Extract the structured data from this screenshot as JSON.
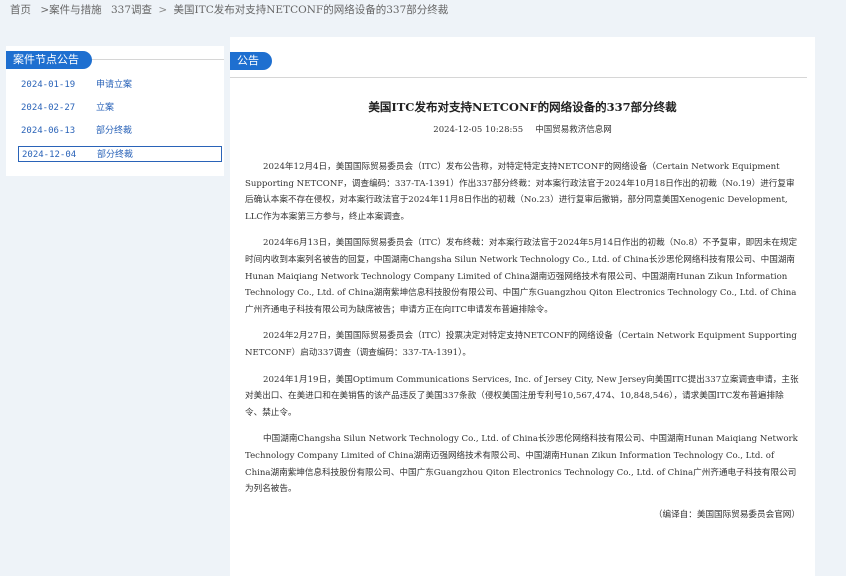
{
  "breadcrumb": {
    "home": "首页",
    "cases": ">案件与措施",
    "section": "337调查",
    "sep": ">",
    "current": "美国ITC发布对支持NETCONF的网络设备的337部分终裁"
  },
  "nodes": {
    "heading": "案件节点公告",
    "items": [
      {
        "date": "2024-01-19",
        "label": "申请立案"
      },
      {
        "date": "2024-02-27",
        "label": "立案"
      },
      {
        "date": "2024-06-13",
        "label": "部分终裁"
      },
      {
        "date": "2024-12-04",
        "label": "部分终裁"
      }
    ]
  },
  "article": {
    "heading": "公告",
    "title": "美国ITC发布对支持NETCONF的网络设备的337部分终裁",
    "datetime": "2024-12-05 10:28:55",
    "source": "中国贸易救济信息网",
    "paragraphs": [
      "2024年12月4日，美国国际贸易委员会（ITC）发布公告称，对特定特定支持NETCONF的网络设备（Certain Network Equipment Supporting NETCONF，调查编码：337-TA-1391）作出337部分终裁：对本案行政法官于2024年10月18日作出的初裁（No.19）进行复审后确认本案不存在侵权，对本案行政法官于2024年11月8日作出的初裁（No.23）进行复审后撤销，部分同意美国Xenogenic Development, LLC作为本案第三方参与，终止本案调查。",
      "2024年6月13日，美国国际贸易委员会（ITC）发布终裁：对本案行政法官于2024年5月14日作出的初裁（No.8）不予复审，即因未在规定时间内收到本案列名被告的回复，中国湖南Changsha Silun Network Technology Co., Ltd. of China长沙思伦网络科技有限公司、中国湖南Hunan Maiqiang Network Technology Company Limited of China湖南迈强网络技术有限公司、中国湖南Hunan Zikun Information Technology Co., Ltd. of China湖南紫坤信息科技股份有限公司、中国广东Guangzhou Qiton Electronics Technology Co., Ltd. of China广州齐通电子科技有限公司为缺席被告；申请方正在向ITC申请发布普遍排除令。",
      "2024年2月27日，美国国际贸易委员会（ITC）投票决定对特定支持NETCONF的网络设备（Certain Network Equipment Supporting NETCONF）启动337调查（调查编码：337-TA-1391）。",
      "2024年1月19日，美国Optimum Communications Services, Inc. of Jersey City, New Jersey向美国ITC提出337立案调查申请，主张对美出口、在美进口和在美销售的该产品违反了美国337条款（侵权美国注册专利号10,567,474、10,848,546），请求美国ITC发布普遍排除令、禁止令。",
      "中国湖南Changsha Silun Network Technology Co., Ltd. of China长沙思伦网络科技有限公司、中国湖南Hunan Maiqiang Network Technology Company Limited of China湖南迈强网络技术有限公司、中国湖南Hunan Zikun Information Technology Co., Ltd. of China湖南紫坤信息科技股份有限公司、中国广东Guangzhou Qiton Electronics Technology Co., Ltd. of China广州齐通电子科技有限公司为列名被告。"
    ],
    "note": "（编译自：美国国际贸易委员会官网）"
  },
  "colors": {
    "accent": "#1e6fd0",
    "link": "#2a63b8",
    "background": "#eef3f8"
  }
}
